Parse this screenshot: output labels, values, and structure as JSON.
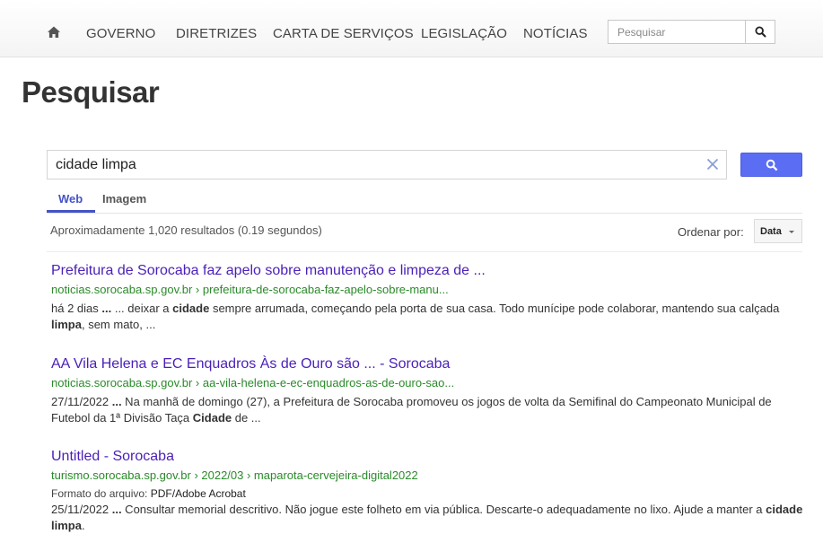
{
  "nav": {
    "home_icon": "home-icon",
    "items": [
      "GOVERNO",
      "DIRETRIZES",
      "CARTA DE SERVIÇOS",
      "LEGISLAÇÃO",
      "NOTÍCIAS"
    ],
    "search_placeholder": "Pesquisar"
  },
  "page": {
    "title": "Pesquisar"
  },
  "search": {
    "query": "cidade limpa",
    "button_color": "#5b6df2",
    "tabs": [
      {
        "label": "Web",
        "active": true
      },
      {
        "label": "Imagem",
        "active": false
      }
    ],
    "results_info": "Aproximadamente 1,020 resultados (0.19 segundos)",
    "sort_label": "Ordenar por:",
    "sort_value": "Data"
  },
  "results": [
    {
      "title": "Prefeitura de Sorocaba faz apelo sobre manutenção e limpeza de ...",
      "url": "noticias.sorocaba.sp.gov.br › prefeitura-de-sorocaba-faz-apelo-sobre-manu...",
      "snippet": [
        {
          "text": "há 2 dias ",
          "b": false
        },
        {
          "text": "...",
          "b": true
        },
        {
          "text": " ... deixar a ",
          "b": false
        },
        {
          "text": "cidade",
          "b": true
        },
        {
          "text": " sempre arrumada, começando pela porta de sua casa. Todo munícipe pode colaborar, mantendo sua calçada ",
          "b": false
        },
        {
          "text": "limpa",
          "b": true
        },
        {
          "text": ", sem mato, ...",
          "b": false
        }
      ]
    },
    {
      "title": "AA Vila Helena e EC Enquadros Às de Ouro são ... - Sorocaba",
      "url": "noticias.sorocaba.sp.gov.br › aa-vila-helena-e-ec-enquadros-as-de-ouro-sao...",
      "snippet": [
        {
          "text": "27/11/2022 ",
          "b": false
        },
        {
          "text": "...",
          "b": true
        },
        {
          "text": " Na manhã de domingo (27), a Prefeitura de Sorocaba promoveu os jogos de volta da Semifinal do Campeonato Municipal de Futebol da 1ª Divisão Taça ",
          "b": false
        },
        {
          "text": "Cidade",
          "b": true
        },
        {
          "text": " de ...",
          "b": false
        }
      ]
    },
    {
      "title": "Untitled - Sorocaba",
      "url": "turismo.sorocaba.sp.gov.br › 2022/03 › maparota-cervejeira-digital2022",
      "format_label": "Formato do arquivo:",
      "format_value": "PDF/Adobe Acrobat",
      "snippet": [
        {
          "text": "25/11/2022 ",
          "b": false
        },
        {
          "text": "...",
          "b": true
        },
        {
          "text": " Consultar memorial descritivo. Não jogue este folheto em via pública. Descarte-o adequadamente no lixo. Ajude a manter a ",
          "b": false
        },
        {
          "text": "cidade limpa",
          "b": true
        },
        {
          "text": ".",
          "b": false
        }
      ]
    }
  ]
}
